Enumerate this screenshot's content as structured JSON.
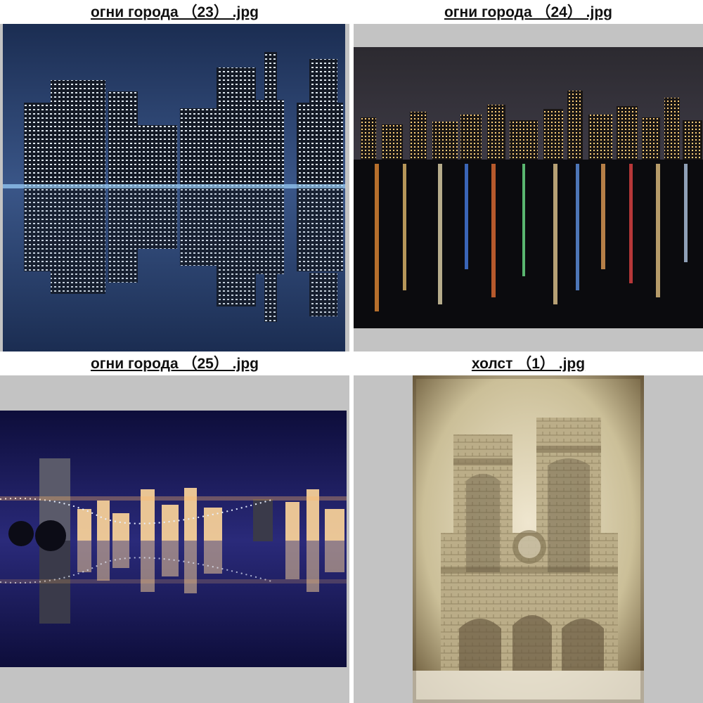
{
  "gallery": {
    "items": [
      {
        "caption": "огни города （23） .jpg"
      },
      {
        "caption": "огни города （24） .jpg"
      },
      {
        "caption": "огни города （25） .jpg"
      },
      {
        "caption": "холст （1） .jpg"
      }
    ]
  }
}
